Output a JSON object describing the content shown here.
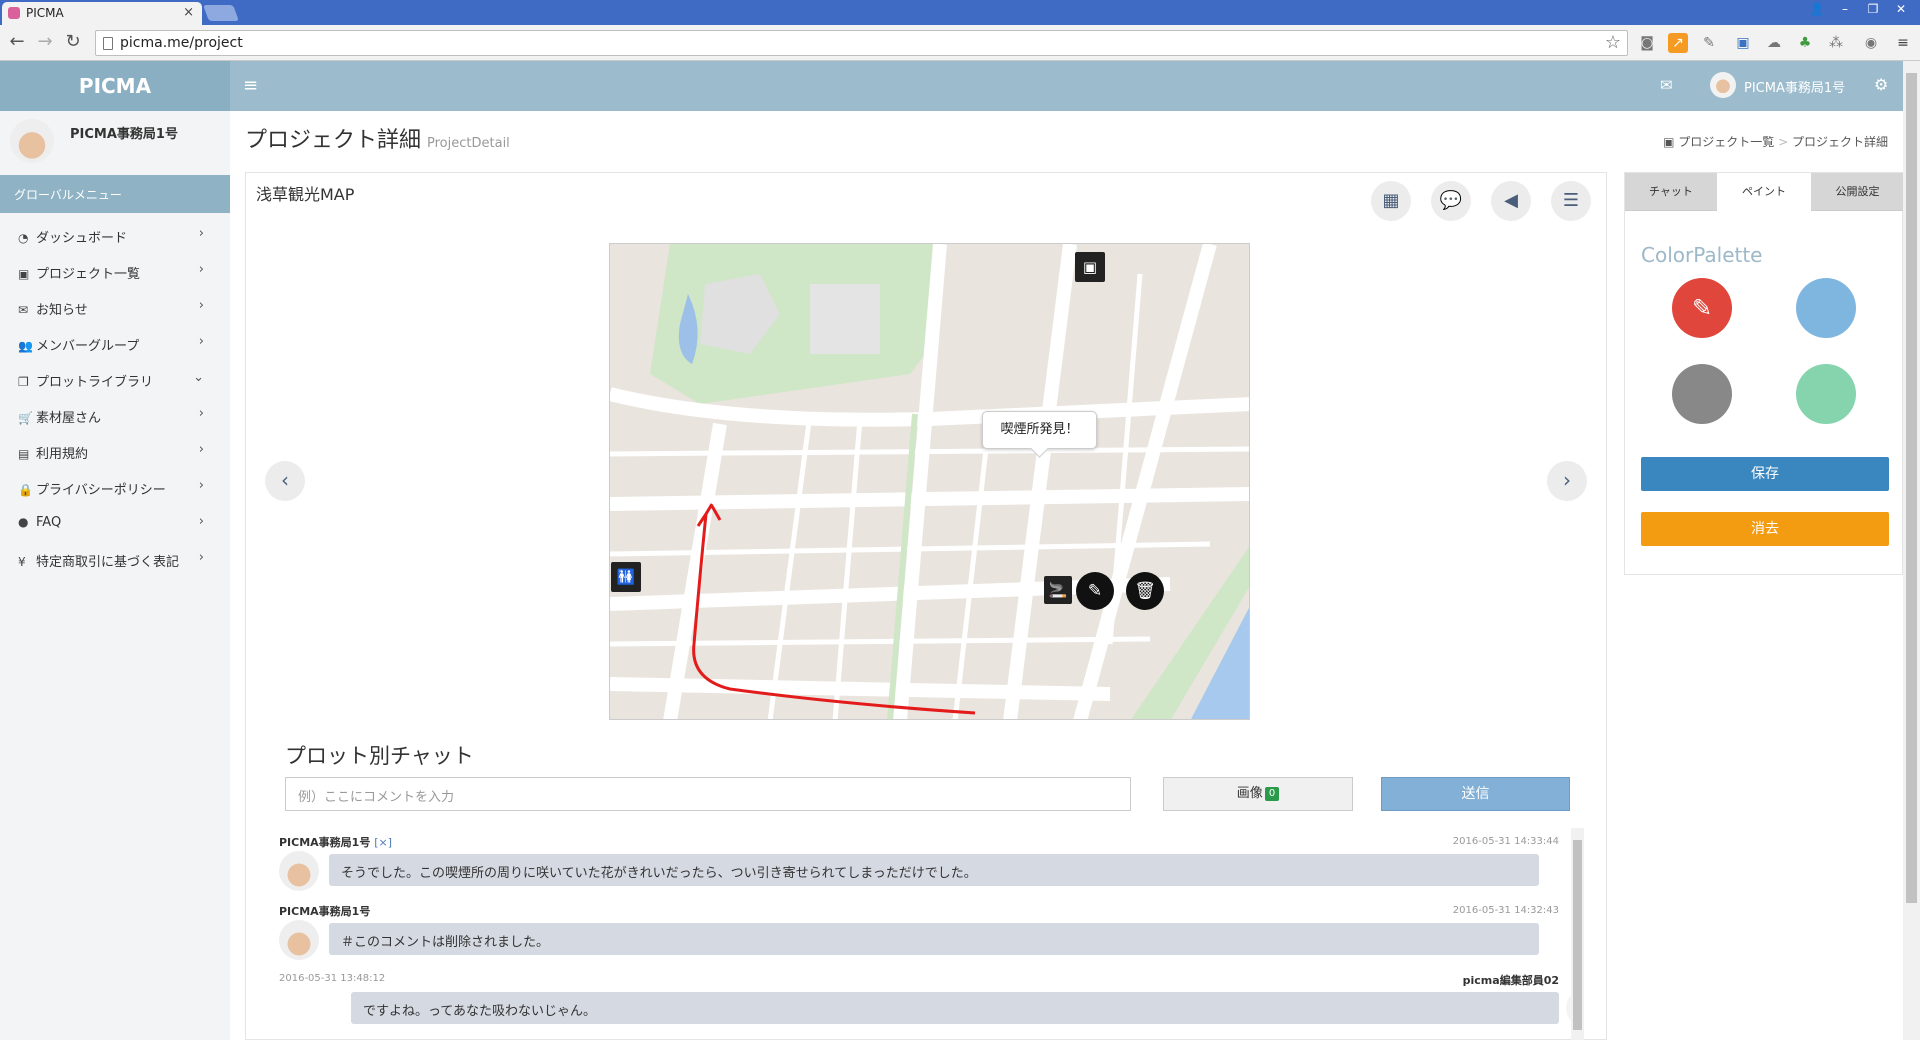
{
  "browser": {
    "tab_title": "PICMA",
    "url": "picma.me/project"
  },
  "header": {
    "brand": "PICMA",
    "user_name": "PICMA事務局1号"
  },
  "sidebar": {
    "user_name": "PICMA事務局1号",
    "menu_heading": "グローバルメニュー",
    "items": [
      {
        "label": "ダッシュボード",
        "icon": "dashboard-icon",
        "glyph": "◔",
        "chev": "›"
      },
      {
        "label": "プロジェクト一覧",
        "icon": "image-icon",
        "glyph": "▣",
        "chev": "›"
      },
      {
        "label": "お知らせ",
        "icon": "mail-icon",
        "glyph": "✉",
        "chev": "›"
      },
      {
        "label": "メンバーグループ",
        "icon": "users-icon",
        "glyph": "👥",
        "chev": "›"
      },
      {
        "label": "プロットライブラリ",
        "icon": "clipboard-icon",
        "glyph": "❐",
        "chev": "⌄"
      },
      {
        "label": "素材屋さん",
        "icon": "cart-icon",
        "glyph": "🛒",
        "chev": "›"
      },
      {
        "label": "利用規約",
        "icon": "book-icon",
        "glyph": "▤",
        "chev": "›"
      },
      {
        "label": "プライバシーポリシー",
        "icon": "lock-icon",
        "glyph": "🔒",
        "chev": "›"
      },
      {
        "label": "FAQ",
        "icon": "info-icon",
        "glyph": "●",
        "chev": "›"
      },
      {
        "label": "特定商取引に基づく表記",
        "icon": "yen-icon",
        "glyph": "¥",
        "chev": "›"
      }
    ]
  },
  "page": {
    "title": "プロジェクト詳細",
    "subtitle": "ProjectDetail",
    "breadcrumb": [
      "プロジェクト一覧",
      "プロジェクト詳細"
    ],
    "breadcrumb_sep": ">"
  },
  "project": {
    "name": "浅草観光MAP",
    "tooltip": "喫煙所発見！"
  },
  "chat": {
    "title": "プロット別チャット",
    "input_placeholder": "例）ここにコメントを入力",
    "image_button": "画像",
    "image_count": "0",
    "send_button": "送信",
    "messages": [
      {
        "name": "PICMA事務局1号",
        "delete": "[×]",
        "time": "2016-05-31 14:33:44",
        "text": "そうでした。この喫煙所の周りに咲いていた花がきれいだったら、つい引き寄せられてしまっただけでした。"
      },
      {
        "name": "PICMA事務局1号",
        "time": "2016-05-31 14:32:43",
        "text": "＃このコメントは削除されました。"
      },
      {
        "name": "picma編集部員02",
        "time": "2016-05-31 13:48:12",
        "text": "ですよね。ってあなた吸わないじゃん。"
      }
    ]
  },
  "right_panel": {
    "tabs": [
      "チャット",
      "ペイント",
      "公開設定"
    ],
    "active_tab": "ペイント",
    "palette_title": "ColorPalette",
    "colors": [
      "#e0463b",
      "#7fb6df",
      "#888888",
      "#86d4ad"
    ],
    "save_button": "保存",
    "clear_button": "消去"
  }
}
